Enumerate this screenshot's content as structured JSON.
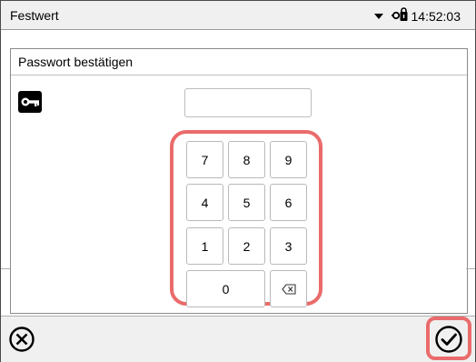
{
  "header": {
    "title": "Festwert",
    "time": "14:52:03",
    "dropdown_icon": "chevron-down-icon",
    "lock_icon": "lock-icon"
  },
  "dialog": {
    "title": "Passwort bestätigen",
    "key_icon": "key-icon",
    "password_value": ""
  },
  "keypad": {
    "rows": [
      [
        "7",
        "8",
        "9"
      ],
      [
        "4",
        "5",
        "6"
      ],
      [
        "1",
        "2",
        "3"
      ]
    ],
    "zero": "0",
    "backspace_icon": "backspace-icon"
  },
  "footer": {
    "cancel_icon": "cancel-circle-icon",
    "confirm_icon": "confirm-check-icon"
  },
  "colors": {
    "highlight": "#ea6b6b",
    "bar_background": "#f0f0f0"
  }
}
